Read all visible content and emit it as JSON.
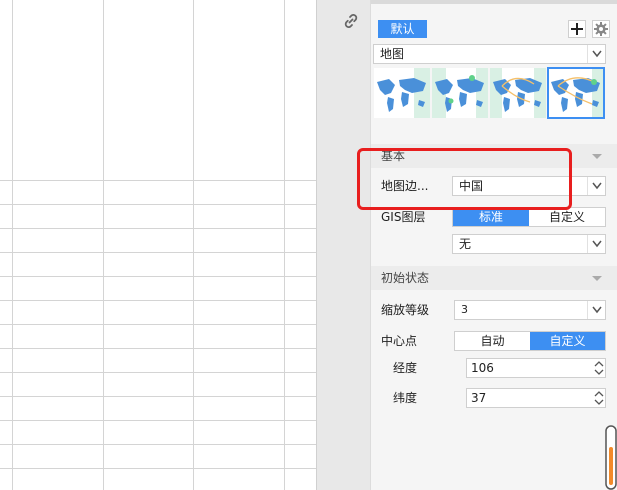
{
  "panel": {
    "tab_default": "默认",
    "map_type_select": "地图",
    "section_basic": "基本",
    "map_boundary_label": "地图边...",
    "map_boundary_value": "中国",
    "gis_layer_label": "GIS图层",
    "gis_standard": "标准",
    "gis_custom": "自定义",
    "gis_sub_select": "无",
    "section_initial": "初始状态",
    "zoom_label": "缩放等级",
    "zoom_value": "3",
    "center_label": "中心点",
    "center_auto": "自动",
    "center_custom": "自定义",
    "longitude_label": "经度",
    "longitude_value": "106",
    "latitude_label": "纬度",
    "latitude_value": "37"
  },
  "colors": {
    "accent": "#3d8ff2",
    "highlight": "#e81e1e"
  },
  "icons": [
    "link-icon",
    "plus-icon",
    "gear-icon",
    "chevron-down-icon",
    "world-map-icon",
    "spinner-arrows-icon"
  ]
}
